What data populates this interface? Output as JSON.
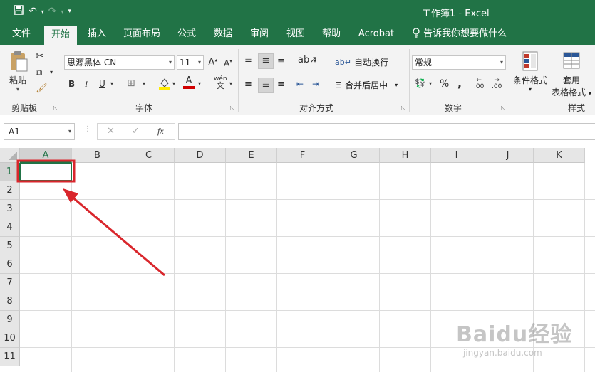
{
  "window": {
    "title": "工作簿1  -  Excel"
  },
  "qat": {
    "save_icon": "save-icon",
    "undo_icon": "undo-icon",
    "redo_icon": "redo-icon",
    "customize_icon": "chevron-down-icon"
  },
  "tabs": [
    {
      "label": "文件"
    },
    {
      "label": "开始"
    },
    {
      "label": "插入"
    },
    {
      "label": "页面布局"
    },
    {
      "label": "公式"
    },
    {
      "label": "数据"
    },
    {
      "label": "审阅"
    },
    {
      "label": "视图"
    },
    {
      "label": "帮助"
    },
    {
      "label": "Acrobat"
    }
  ],
  "tell_me": "告诉我你想要做什么",
  "ribbon": {
    "clipboard": {
      "paste": "粘贴",
      "label": "剪贴板"
    },
    "font": {
      "name": "思源黑体 CN",
      "size": "11",
      "grow": "A",
      "shrink": "A",
      "bold": "B",
      "italic": "I",
      "underline": "U",
      "font_color": "A",
      "phonetic": "wén",
      "label": "字体"
    },
    "alignment": {
      "wrap": "自动换行",
      "merge": "合并后居中",
      "label": "对齐方式"
    },
    "number": {
      "format": "常规",
      "percent": "%",
      "comma": ",",
      "inc_decimal": ".00",
      "dec_decimal": ".00",
      "label": "数字"
    },
    "styles": {
      "conditional": "条件格式",
      "table_line1": "套用",
      "table_line2": "表格格式",
      "label": "样式"
    }
  },
  "formula_bar": {
    "name_box": "A1",
    "cancel": "✕",
    "enter": "✓",
    "fx": "fx",
    "value": ""
  },
  "grid": {
    "columns": [
      "A",
      "B",
      "C",
      "D",
      "E",
      "F",
      "G",
      "H",
      "I",
      "J",
      "K"
    ],
    "rows": [
      "1",
      "2",
      "3",
      "4",
      "5",
      "6",
      "7",
      "8",
      "9",
      "10",
      "11"
    ],
    "active_cell": "A1"
  },
  "annotation": {
    "color": "#d9262c"
  },
  "watermark": {
    "line1": "Baidu经验",
    "line2": "jingyan.baidu.com"
  },
  "colors": {
    "accent": "#217346"
  }
}
